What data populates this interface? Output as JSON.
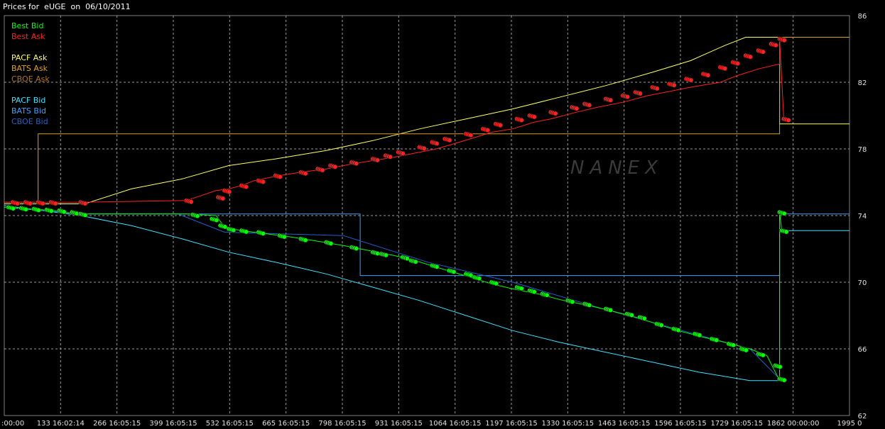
{
  "header": {
    "title": "Prices for  eUGE  on  06/10/2011"
  },
  "legend": {
    "best_bid": {
      "label": "Best Bid",
      "color": "#00ff00"
    },
    "best_ask": {
      "label": "Best Ask",
      "color": "#ff2020"
    },
    "pacf_ask": {
      "label": "PACF Ask",
      "color": "#ffff66"
    },
    "bats_ask": {
      "label": "BATS Ask",
      "color": "#e0a020"
    },
    "cboe_ask": {
      "label": "CBOE Ask",
      "color": "#b07020"
    },
    "pacf_bid": {
      "label": "PACF Bid",
      "color": "#40e0ff"
    },
    "bats_bid": {
      "label": "BATS Bid",
      "color": "#40a0ff"
    },
    "cboe_bid": {
      "label": "CBOE Bid",
      "color": "#2060d0"
    }
  },
  "watermark": "NANEX",
  "chart_data": {
    "type": "line",
    "title": "Prices for  eUGE  on  06/10/2011",
    "xlim": [
      0,
      1995
    ],
    "ylim": [
      62,
      86
    ],
    "y_ticks": [
      "86",
      "82",
      "78",
      "74",
      "70",
      "66",
      "62"
    ],
    "y_tick_values": [
      86,
      82,
      78,
      74,
      70,
      66,
      62
    ],
    "x_ticks": [
      {
        "v": 0,
        "label": ":00:00"
      },
      {
        "v": 133,
        "label": "133 16:02:14"
      },
      {
        "v": 266,
        "label": "266 16:05:15"
      },
      {
        "v": 399,
        "label": "399 16:05:15"
      },
      {
        "v": 532,
        "label": "532 16:05:15"
      },
      {
        "v": 665,
        "label": "665 16:05:15"
      },
      {
        "v": 798,
        "label": "798 16:05:15"
      },
      {
        "v": 931,
        "label": "931 16:05:15"
      },
      {
        "v": 1064,
        "label": "1064 16:05:15"
      },
      {
        "v": 1197,
        "label": "1197 16:05:15"
      },
      {
        "v": 1330,
        "label": "1330 16:05:15"
      },
      {
        "v": 1463,
        "label": "1463 16:05:15"
      },
      {
        "v": 1596,
        "label": "1596 16:05:15"
      },
      {
        "v": 1729,
        "label": "1729 16:05:15"
      },
      {
        "v": 1862,
        "label": "1862 00:00:00"
      },
      {
        "v": 1995,
        "label": "1995 0"
      }
    ],
    "grid": true,
    "series": [
      {
        "name": "PACF Ask",
        "color": "#ffff66",
        "points": [
          [
            0,
            74.7
          ],
          [
            70,
            74.7
          ],
          [
            190,
            74.7
          ],
          [
            300,
            75.6
          ],
          [
            420,
            76.2
          ],
          [
            530,
            77
          ],
          [
            640,
            77.4
          ],
          [
            760,
            77.9
          ],
          [
            870,
            78.5
          ],
          [
            980,
            79.2
          ],
          [
            1090,
            79.8
          ],
          [
            1200,
            80.4
          ],
          [
            1310,
            81.1
          ],
          [
            1420,
            81.8
          ],
          [
            1530,
            82.6
          ],
          [
            1620,
            83.3
          ],
          [
            1700,
            84.2
          ],
          [
            1750,
            84.7
          ],
          [
            1830,
            84.7
          ],
          [
            1830,
            79.5
          ],
          [
            1995,
            79.5
          ]
        ]
      },
      {
        "name": "BATS Ask",
        "color": "#e0a020",
        "points": [
          [
            0,
            74.8
          ],
          [
            80,
            74.8
          ],
          [
            80,
            78.9
          ],
          [
            1830,
            78.9
          ],
          [
            1830,
            84.7
          ],
          [
            1995,
            84.7
          ]
        ]
      },
      {
        "name": "PACF Bid",
        "color": "#40e0ff",
        "points": [
          [
            0,
            74.6
          ],
          [
            180,
            74.0
          ],
          [
            300,
            73.4
          ],
          [
            420,
            72.6
          ],
          [
            530,
            71.8
          ],
          [
            640,
            71.2
          ],
          [
            760,
            70.5
          ],
          [
            870,
            69.7
          ],
          [
            980,
            68.9
          ],
          [
            1090,
            68.0
          ],
          [
            1200,
            67.1
          ],
          [
            1310,
            66.4
          ],
          [
            1420,
            65.8
          ],
          [
            1530,
            65.2
          ],
          [
            1640,
            64.6
          ],
          [
            1760,
            64.1
          ],
          [
            1830,
            64.1
          ],
          [
            1830,
            73.1
          ],
          [
            1995,
            73.1
          ]
        ]
      },
      {
        "name": "BATS Bid",
        "color": "#40a0ff",
        "points": [
          [
            0,
            74.5
          ],
          [
            180,
            74.1
          ],
          [
            840,
            74.1
          ],
          [
            840,
            70.4
          ],
          [
            1830,
            70.4
          ],
          [
            1830,
            74.1
          ],
          [
            1995,
            74.1
          ]
        ]
      },
      {
        "name": "CBOE Bid",
        "color": "#2060d0",
        "points": [
          [
            170,
            74.1
          ],
          [
            410,
            74.1
          ],
          [
            520,
            73.0
          ],
          [
            800,
            72.8
          ],
          [
            1000,
            71.2
          ],
          [
            1200,
            70.0
          ],
          [
            1400,
            68.5
          ],
          [
            1600,
            67.1
          ],
          [
            1760,
            66.0
          ],
          [
            1830,
            64.2
          ]
        ]
      },
      {
        "name": "Best Ask",
        "color": "#ff2020",
        "marker": "circle",
        "points": [
          [
            0,
            74.8
          ],
          [
            100,
            74.8
          ],
          [
            180,
            74.8
          ],
          [
            430,
            74.9
          ],
          [
            500,
            75.5
          ],
          [
            530,
            75.6
          ],
          [
            560,
            75.8
          ],
          [
            590,
            76.1
          ],
          [
            650,
            76.4
          ],
          [
            700,
            76.6
          ],
          [
            760,
            76.8
          ],
          [
            820,
            77.1
          ],
          [
            870,
            77.3
          ],
          [
            920,
            77.5
          ],
          [
            960,
            77.7
          ],
          [
            1020,
            78.0
          ],
          [
            1060,
            78.3
          ],
          [
            1100,
            78.6
          ],
          [
            1150,
            79.0
          ],
          [
            1200,
            79.2
          ],
          [
            1250,
            79.6
          ],
          [
            1290,
            79.8
          ],
          [
            1350,
            80.2
          ],
          [
            1400,
            80.5
          ],
          [
            1460,
            80.8
          ],
          [
            1520,
            81.2
          ],
          [
            1560,
            81.4
          ],
          [
            1620,
            81.7
          ],
          [
            1690,
            82.0
          ],
          [
            1730,
            82.4
          ],
          [
            1780,
            82.8
          ],
          [
            1830,
            83.1
          ],
          [
            1830,
            84.6
          ],
          [
            1840,
            79.8
          ]
        ]
      },
      {
        "name": "Best Bid",
        "color": "#00ff00",
        "marker": "circle",
        "points": [
          [
            0,
            74.5
          ],
          [
            60,
            74.4
          ],
          [
            120,
            74.3
          ],
          [
            170,
            74.1
          ],
          [
            430,
            74.1
          ],
          [
            500,
            74.0
          ],
          [
            520,
            73.3
          ],
          [
            560,
            73.1
          ],
          [
            620,
            72.9
          ],
          [
            680,
            72.7
          ],
          [
            730,
            72.5
          ],
          [
            800,
            72.2
          ],
          [
            860,
            71.9
          ],
          [
            920,
            71.6
          ],
          [
            970,
            71.3
          ],
          [
            1020,
            70.9
          ],
          [
            1060,
            70.6
          ],
          [
            1100,
            70.3
          ],
          [
            1150,
            69.9
          ],
          [
            1200,
            69.6
          ],
          [
            1260,
            69.3
          ],
          [
            1320,
            68.9
          ],
          [
            1380,
            68.6
          ],
          [
            1430,
            68.3
          ],
          [
            1490,
            67.9
          ],
          [
            1540,
            67.5
          ],
          [
            1590,
            67.1
          ],
          [
            1650,
            66.7
          ],
          [
            1700,
            66.4
          ],
          [
            1760,
            66.0
          ],
          [
            1800,
            65.6
          ],
          [
            1830,
            64.1
          ],
          [
            1830,
            74.2
          ],
          [
            1835,
            73.1
          ]
        ]
      }
    ],
    "best_bid_dots": [
      [
        10,
        74.5
      ],
      [
        40,
        74.45
      ],
      [
        70,
        74.4
      ],
      [
        100,
        74.35
      ],
      [
        130,
        74.3
      ],
      [
        160,
        74.2
      ],
      [
        180,
        74.1
      ],
      [
        445,
        74.05
      ],
      [
        490,
        73.8
      ],
      [
        510,
        73.4
      ],
      [
        530,
        73.2
      ],
      [
        560,
        73.1
      ],
      [
        600,
        73.0
      ],
      [
        650,
        72.8
      ],
      [
        700,
        72.6
      ],
      [
        760,
        72.4
      ],
      [
        820,
        72.1
      ],
      [
        870,
        71.8
      ],
      [
        890,
        71.7
      ],
      [
        940,
        71.5
      ],
      [
        960,
        71.3
      ],
      [
        1010,
        71.0
      ],
      [
        1050,
        70.7
      ],
      [
        1090,
        70.5
      ],
      [
        1110,
        70.3
      ],
      [
        1150,
        70.0
      ],
      [
        1210,
        69.7
      ],
      [
        1240,
        69.5
      ],
      [
        1270,
        69.3
      ],
      [
        1330,
        68.9
      ],
      [
        1370,
        68.7
      ],
      [
        1420,
        68.4
      ],
      [
        1470,
        68.1
      ],
      [
        1500,
        67.9
      ],
      [
        1540,
        67.5
      ],
      [
        1580,
        67.2
      ],
      [
        1630,
        66.9
      ],
      [
        1670,
        66.6
      ],
      [
        1710,
        66.3
      ],
      [
        1740,
        66.0
      ],
      [
        1780,
        65.7
      ],
      [
        1820,
        65.0
      ],
      [
        1830,
        64.2
      ],
      [
        1830,
        74.2
      ],
      [
        1835,
        73.1
      ]
    ],
    "best_ask_dots": [
      [
        20,
        74.8
      ],
      [
        50,
        74.8
      ],
      [
        80,
        74.8
      ],
      [
        110,
        74.8
      ],
      [
        180,
        74.8
      ],
      [
        430,
        74.9
      ],
      [
        505,
        75.1
      ],
      [
        520,
        75.5
      ],
      [
        560,
        75.8
      ],
      [
        600,
        76.1
      ],
      [
        640,
        76.4
      ],
      [
        700,
        76.6
      ],
      [
        740,
        76.8
      ],
      [
        770,
        77.0
      ],
      [
        820,
        77.2
      ],
      [
        870,
        77.4
      ],
      [
        900,
        77.6
      ],
      [
        930,
        77.8
      ],
      [
        980,
        78.1
      ],
      [
        1010,
        78.4
      ],
      [
        1040,
        78.6
      ],
      [
        1090,
        78.9
      ],
      [
        1130,
        79.2
      ],
      [
        1160,
        79.5
      ],
      [
        1210,
        79.8
      ],
      [
        1240,
        80.0
      ],
      [
        1290,
        80.2
      ],
      [
        1340,
        80.5
      ],
      [
        1370,
        80.7
      ],
      [
        1420,
        81.0
      ],
      [
        1460,
        81.2
      ],
      [
        1490,
        81.4
      ],
      [
        1530,
        81.7
      ],
      [
        1570,
        81.9
      ],
      [
        1610,
        82.2
      ],
      [
        1650,
        82.5
      ],
      [
        1690,
        82.9
      ],
      [
        1720,
        83.2
      ],
      [
        1750,
        83.6
      ],
      [
        1780,
        83.9
      ],
      [
        1810,
        84.3
      ],
      [
        1830,
        84.6
      ],
      [
        1840,
        79.8
      ]
    ]
  }
}
